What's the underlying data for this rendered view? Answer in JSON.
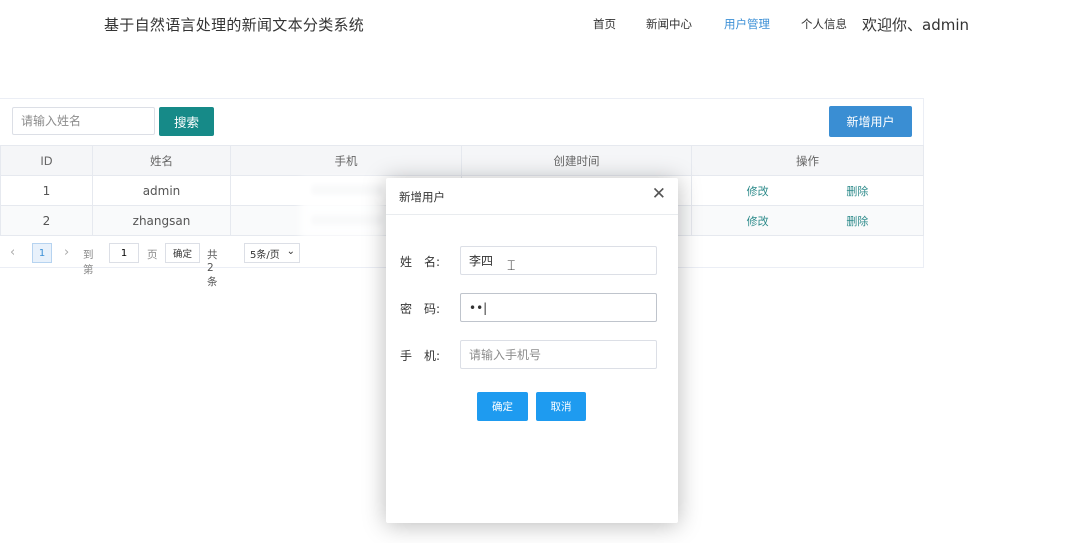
{
  "header": {
    "title": "基于自然语言处理的新闻文本分类系统",
    "nav": [
      {
        "label": "首页",
        "active": false
      },
      {
        "label": "新闻中心",
        "active": false
      },
      {
        "label": "用户管理",
        "active": true
      },
      {
        "label": "个人信息",
        "active": false
      }
    ],
    "welcome": "欢迎你、admin"
  },
  "toolbar": {
    "search_placeholder": "请输入姓名",
    "search_button": "搜索",
    "add_button": "新增用户"
  },
  "table": {
    "columns": [
      "ID",
      "姓名",
      "手机",
      "创建时间",
      "操作"
    ],
    "rows": [
      {
        "id": "1",
        "name": "admin",
        "edit": "修改",
        "delete": "删除"
      },
      {
        "id": "2",
        "name": "zhangsan",
        "edit": "修改",
        "delete": "删除"
      }
    ]
  },
  "pagination": {
    "current_page": "1",
    "goto_label": "到第",
    "goto_value": "1",
    "page_suffix": "页",
    "confirm": "确定",
    "total": "共 2 条",
    "page_size": "5条/页"
  },
  "modal": {
    "title": "新增用户",
    "name_label": "姓　名:",
    "name_value": "李四",
    "password_label": "密　码:",
    "password_value": "••|",
    "phone_label": "手　机:",
    "phone_placeholder": "请输入手机号",
    "ok_button": "确定",
    "cancel_button": "取消"
  },
  "colors": {
    "accent_blue": "#3a8ed3",
    "search_teal": "#168a88",
    "modal_button": "#1e9bf0"
  }
}
